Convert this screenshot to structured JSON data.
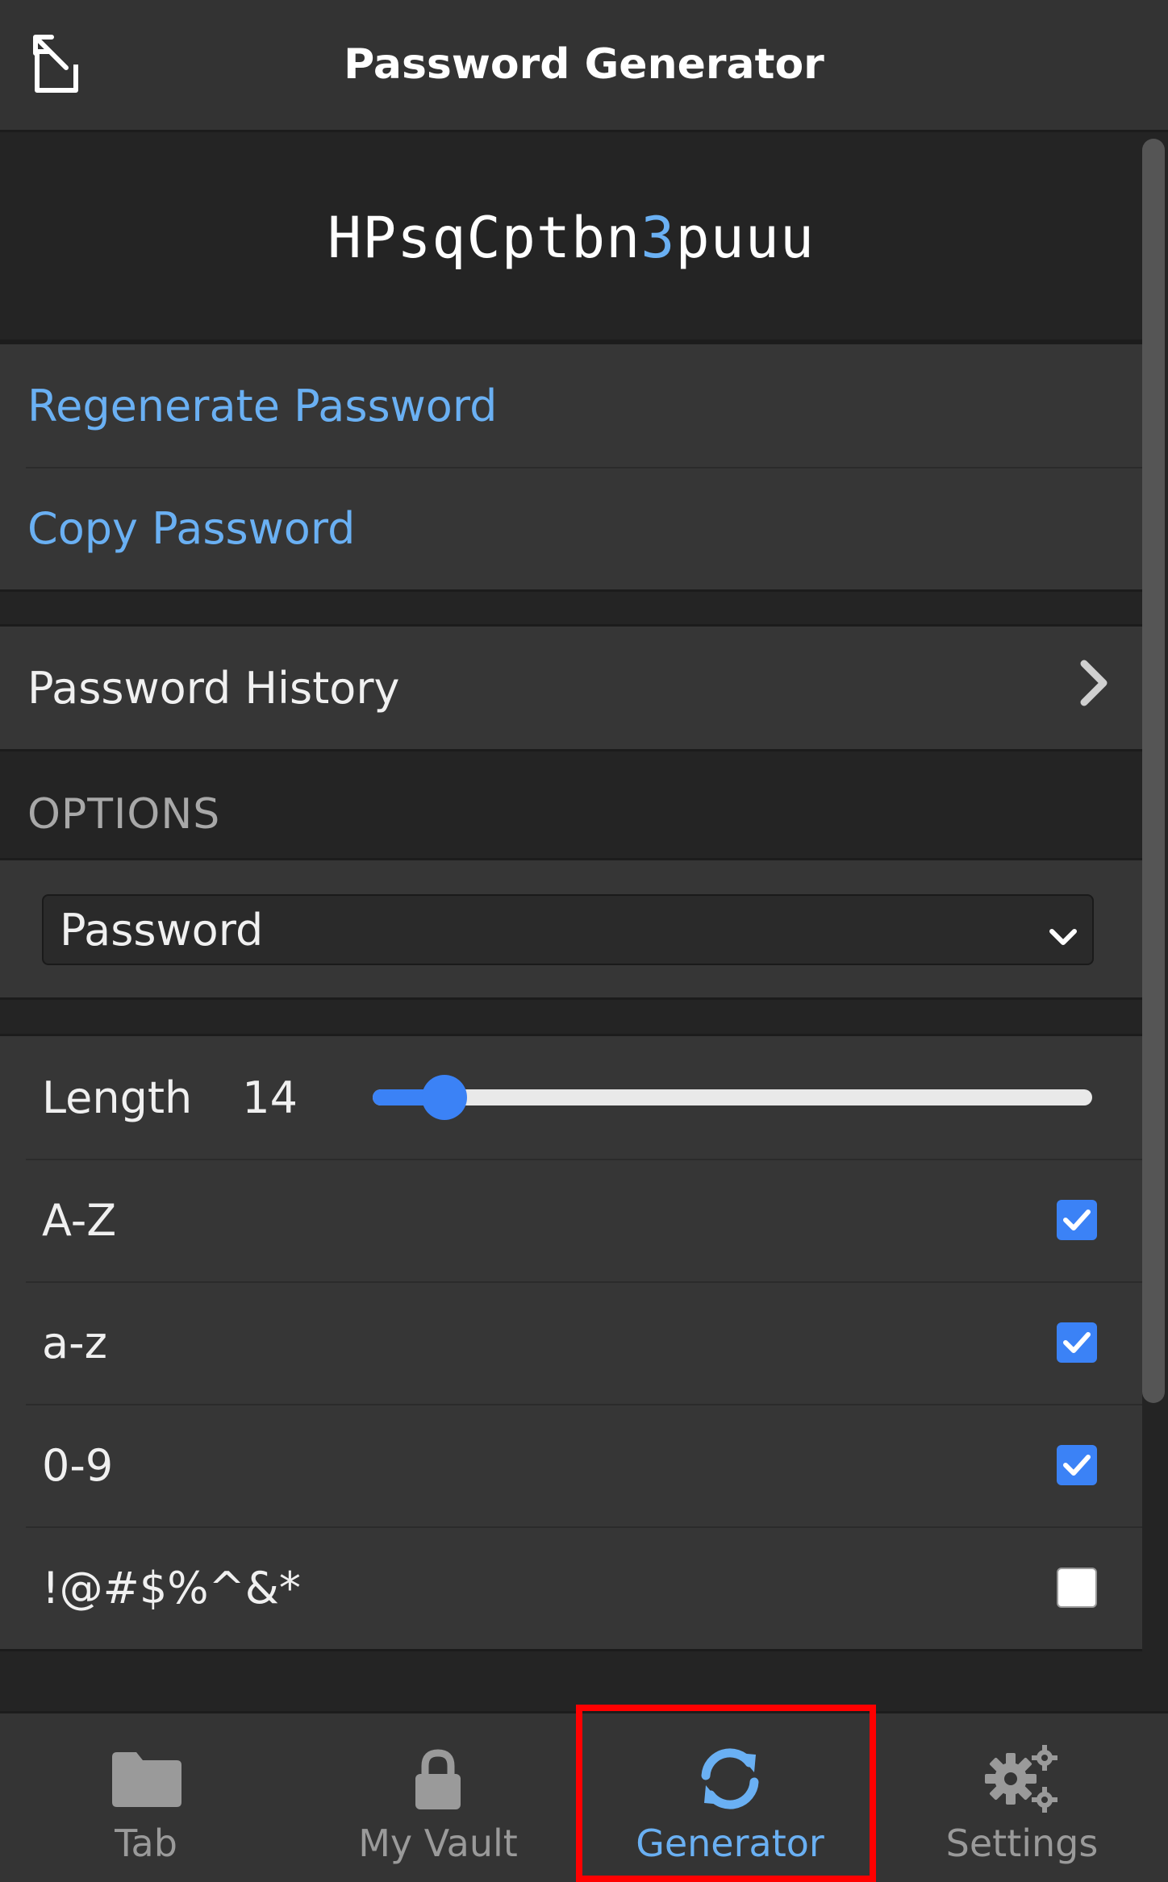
{
  "header": {
    "title": "Password Generator",
    "pop_out_icon": "pop-out-icon"
  },
  "password": {
    "prefix": "HPsqCptbn",
    "digit": "3",
    "suffix": "puuu"
  },
  "actions": {
    "regenerate": "Regenerate Password",
    "copy": "Copy Password"
  },
  "history": {
    "label": "Password History"
  },
  "options": {
    "section_label": "OPTIONS",
    "type_selected": "Password",
    "length_label": "Length",
    "length_value": "14",
    "length_slider_fraction": 0.1,
    "charsets": [
      {
        "label": "A-Z",
        "checked": true
      },
      {
        "label": "a-z",
        "checked": true
      },
      {
        "label": "0-9",
        "checked": true
      },
      {
        "label": "!@#$%^&*",
        "checked": false
      }
    ]
  },
  "tabs": [
    {
      "label": "Tab",
      "icon": "folder-icon",
      "active": false
    },
    {
      "label": "My Vault",
      "icon": "lock-icon",
      "active": false
    },
    {
      "label": "Generator",
      "icon": "refresh-icon",
      "active": true
    },
    {
      "label": "Settings",
      "icon": "gears-icon",
      "active": false
    }
  ],
  "colors": {
    "accent": "#6ab0f3",
    "checkbox": "#3b82f6",
    "highlight": "#ff0000"
  }
}
